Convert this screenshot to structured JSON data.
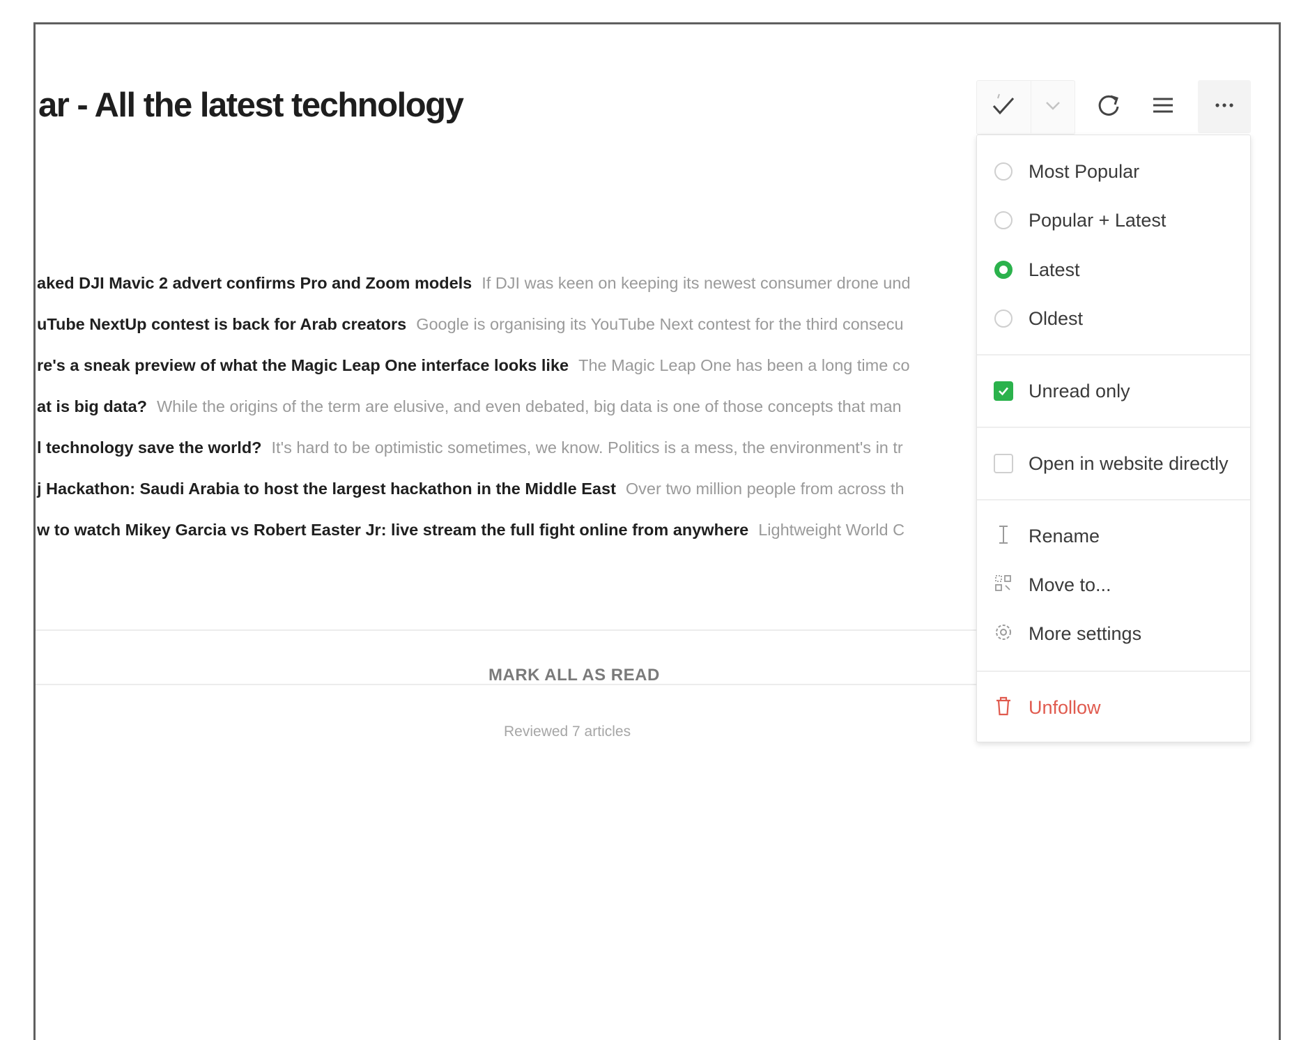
{
  "page": {
    "title": "ar - All the latest technology"
  },
  "toolbar": {
    "mark_read_icon": "check-icon",
    "mark_read_dropdown_icon": "chevron-down-icon",
    "refresh_icon": "refresh-icon",
    "layout_icon": "list-icon",
    "more_icon": "more-horizontal-icon"
  },
  "articles": [
    {
      "title": "aked DJI Mavic 2 advert confirms Pro and Zoom models",
      "snippet": "If DJI was keen on keeping its newest consumer drone und"
    },
    {
      "title": "uTube NextUp contest is back for Arab creators",
      "snippet": "Google is organising its YouTube Next contest for the third consecu"
    },
    {
      "title": "re's a sneak preview of what the Magic Leap One interface looks like",
      "snippet": "The Magic Leap One has been a long time co"
    },
    {
      "title": "at is big data?",
      "snippet": "While the origins of the term are elusive, and even debated, big data is one of those concepts that man"
    },
    {
      "title": "l technology save the world?",
      "snippet": "It's hard to be optimistic sometimes, we know. Politics is a mess, the environment's in tr"
    },
    {
      "title": "j Hackathon: Saudi Arabia to host the largest hackathon in the Middle East",
      "snippet": "Over two million people from across th"
    },
    {
      "title": "w to watch Mikey Garcia vs Robert Easter Jr: live stream the full fight online from anywhere",
      "snippet": "Lightweight World C"
    }
  ],
  "footer": {
    "mark_all_label": "MARK ALL AS READ",
    "reviewed_text": "Reviewed 7 articles"
  },
  "menu": {
    "sort_options": [
      {
        "label": "Most Popular",
        "selected": false
      },
      {
        "label": "Popular + Latest",
        "selected": false
      },
      {
        "label": "Latest",
        "selected": true
      },
      {
        "label": "Oldest",
        "selected": false
      }
    ],
    "unread_only": {
      "label": "Unread only",
      "checked": true
    },
    "open_in_website": {
      "label": "Open in website directly",
      "checked": false
    },
    "rename": {
      "label": "Rename",
      "icon": "text-cursor-icon"
    },
    "move_to": {
      "label": "Move to...",
      "icon": "move-icon"
    },
    "more_settings": {
      "label": "More settings",
      "icon": "gear-icon"
    },
    "unfollow": {
      "label": "Unfollow",
      "icon": "trash-icon"
    }
  },
  "colors": {
    "accent": "#2bb24c",
    "danger": "#e05a4e"
  }
}
